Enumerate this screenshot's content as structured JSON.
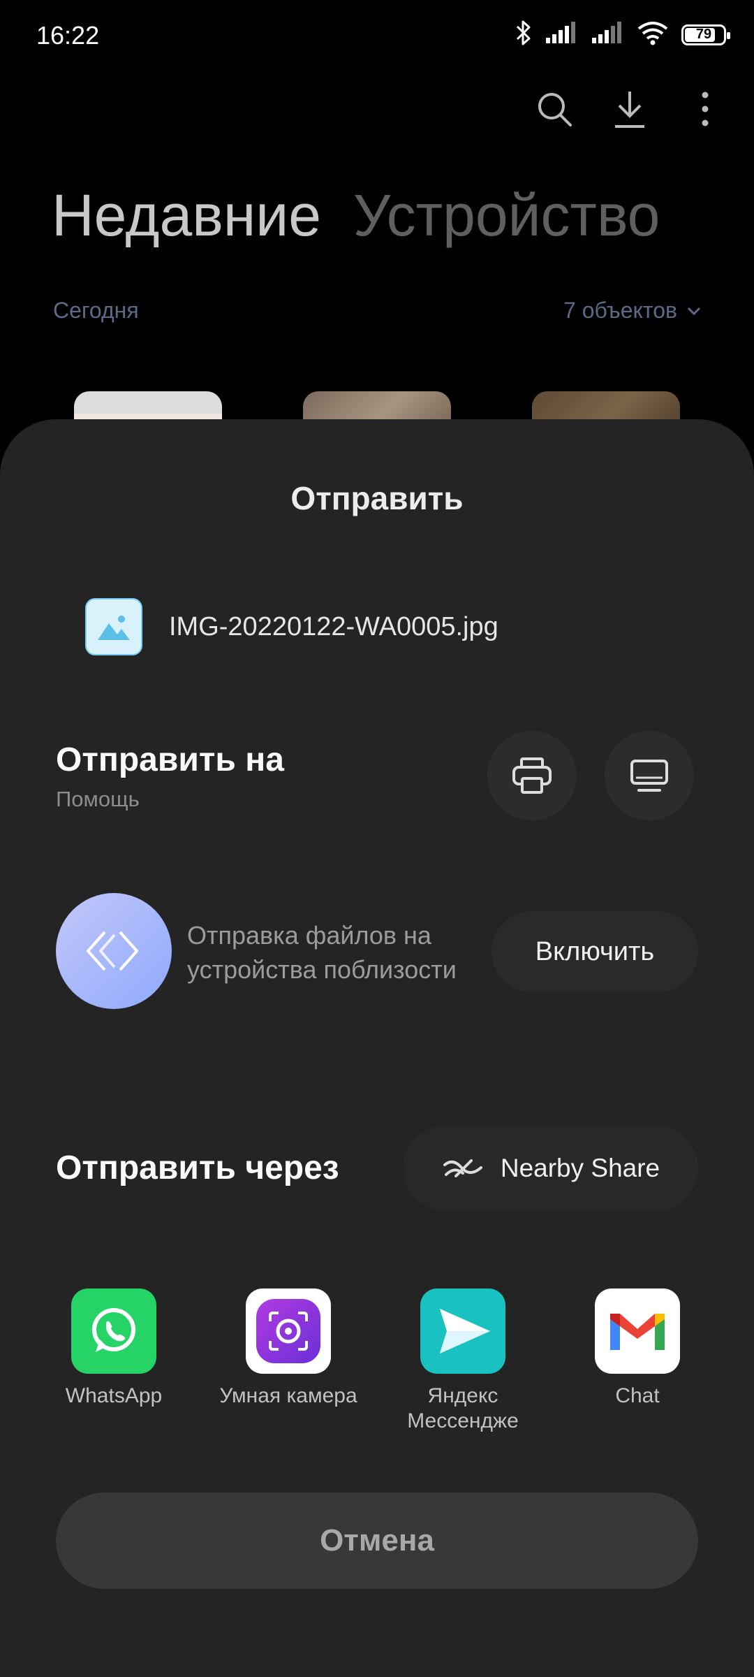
{
  "status_bar": {
    "time": "16:22",
    "battery": "79",
    "battery_level": 0.79
  },
  "background_app": {
    "tabs": [
      {
        "label": "Недавние"
      },
      {
        "label": "Устройство"
      }
    ],
    "section": {
      "label": "Сегодня",
      "count": "7 объектов"
    }
  },
  "sheet": {
    "title": "Отправить",
    "file": {
      "name": "IMG-20220122-WA0005.jpg"
    },
    "send_to": {
      "title": "Отправить на",
      "subtitle": "Помощь"
    },
    "nearby": {
      "text": "Отправка файлов на устройства поблизости",
      "button": "Включить"
    },
    "send_via": {
      "title": "Отправить через",
      "nearby_share": "Nearby Share"
    },
    "apps": [
      {
        "label": "WhatsApp",
        "icon": "whatsapp-icon",
        "color": "#25D366"
      },
      {
        "label": "Умная камера",
        "icon": "smart-camera-icon",
        "color": "#8A2BE2"
      },
      {
        "label": "Яндекс Мессендже",
        "icon": "yandex-messenger-icon",
        "color": "#19C2C0"
      },
      {
        "label": "Chat",
        "icon": "gmail-icon",
        "color": "#EA4335"
      }
    ],
    "cancel": "Отмена"
  }
}
